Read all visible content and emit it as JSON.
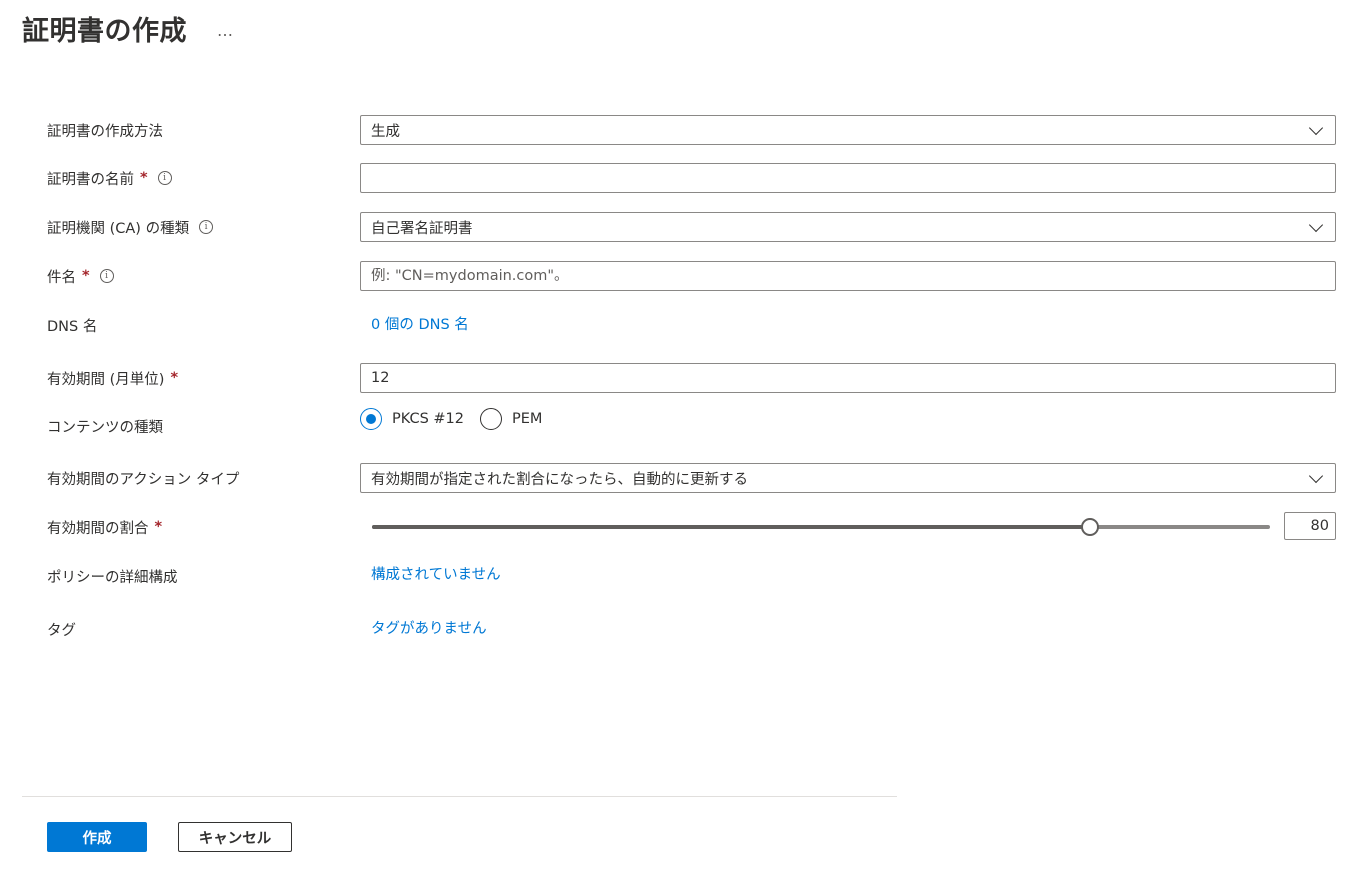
{
  "header": {
    "title": "証明書の作成",
    "more": "…"
  },
  "form": {
    "method": {
      "label": "証明書の作成方法",
      "value": "生成"
    },
    "name": {
      "label": "証明書の名前",
      "required": "*",
      "value": ""
    },
    "ca_type": {
      "label": "証明機関 (CA) の種類",
      "value": "自己署名証明書"
    },
    "subject": {
      "label": "件名",
      "required": "*",
      "placeholder": "例: \"CN=mydomain.com\"。"
    },
    "dns": {
      "label": "DNS 名",
      "link": "0 個の DNS 名"
    },
    "validity": {
      "label": "有効期間 (月単位)",
      "required": "*",
      "value": "12"
    },
    "content_type": {
      "label": "コンテンツの種類",
      "options": [
        {
          "label": "PKCS #12",
          "selected": true
        },
        {
          "label": "PEM",
          "selected": false
        }
      ]
    },
    "action_type": {
      "label": "有効期間のアクション タイプ",
      "value": "有効期間が指定された割合になったら、自動的に更新する"
    },
    "percentage": {
      "label": "有効期間の割合",
      "required": "*",
      "value": 80,
      "min": 0,
      "max": 100,
      "display": "80"
    },
    "policy": {
      "label": "ポリシーの詳細構成",
      "link": "構成されていません"
    },
    "tags": {
      "label": "タグ",
      "link": "タグがありません"
    }
  },
  "footer": {
    "create_label": "作成",
    "cancel_label": "キャンセル"
  },
  "colors": {
    "accent": "#0078d4",
    "required": "#a4262c",
    "text": "#323130"
  }
}
